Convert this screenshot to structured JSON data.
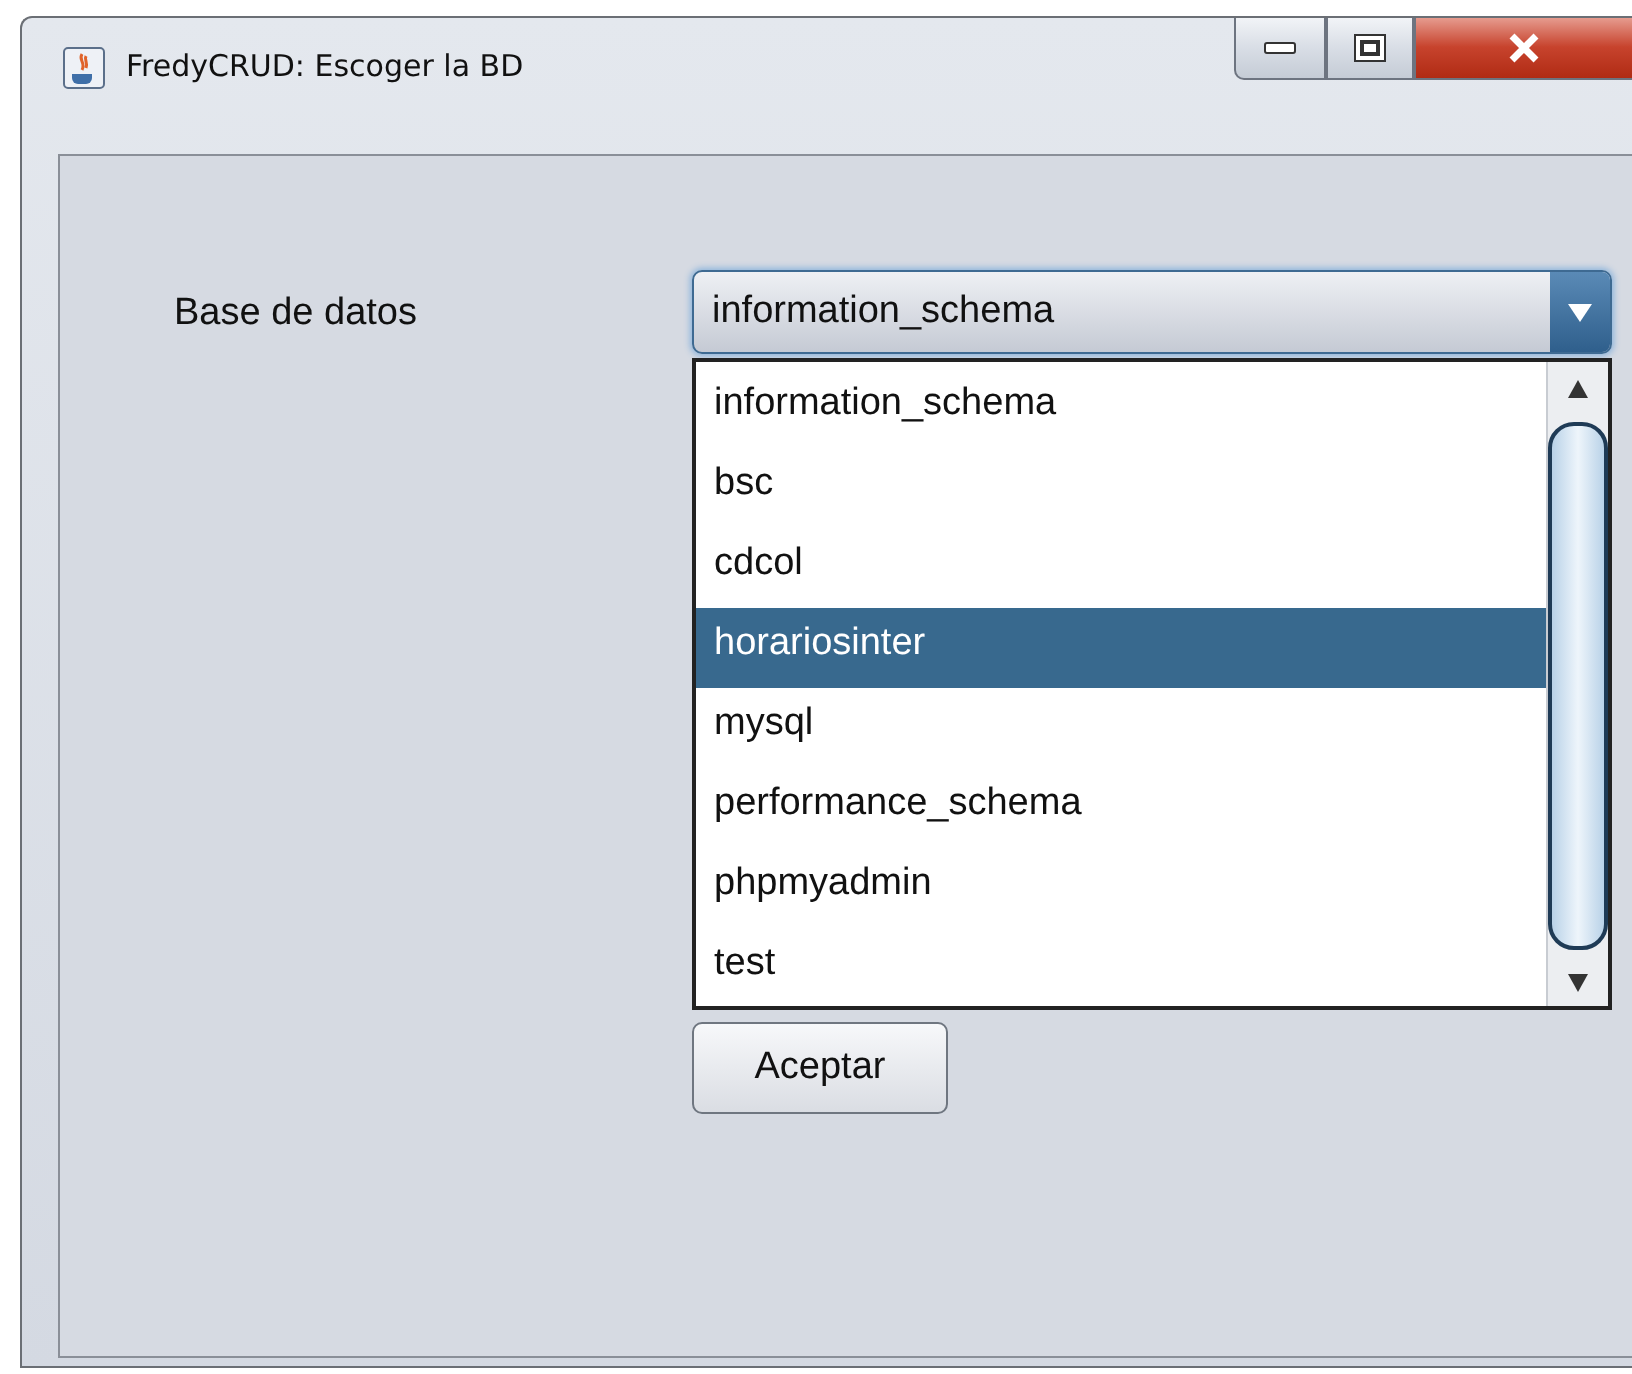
{
  "window": {
    "title": "FredyCRUD: Escoger la BD"
  },
  "form": {
    "label": "Base de datos",
    "combo": {
      "value": "information_schema",
      "expanded": true
    },
    "options": [
      {
        "label": "information_schema",
        "selected": false
      },
      {
        "label": "bsc",
        "selected": false
      },
      {
        "label": "cdcol",
        "selected": false
      },
      {
        "label": "horariosinter",
        "selected": true
      },
      {
        "label": "mysql",
        "selected": false
      },
      {
        "label": "performance_schema",
        "selected": false
      },
      {
        "label": "phpmyadmin",
        "selected": false
      },
      {
        "label": "test",
        "selected": false
      }
    ],
    "button": "Aceptar"
  }
}
